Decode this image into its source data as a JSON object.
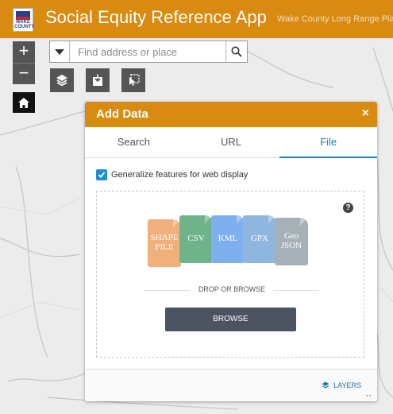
{
  "header": {
    "logo_text": "WAKE COUNTY",
    "title": "Social Equity Reference App",
    "subtitle": "Wake County Long Range Pla"
  },
  "map_controls": {
    "zoom_in": "+",
    "zoom_out": "−"
  },
  "search": {
    "placeholder": "Find address or place"
  },
  "add_data": {
    "title": "Add Data",
    "close": "×",
    "tabs": [
      {
        "label": "Search",
        "active": false
      },
      {
        "label": "URL",
        "active": false
      },
      {
        "label": "File",
        "active": true
      }
    ],
    "generalize_label": "Generalize features for web display",
    "generalize_checked": true,
    "help": "?",
    "file_types": [
      {
        "label": "SHAPE FILE",
        "color": "#f0b07c"
      },
      {
        "label": "CSV",
        "color": "#6fb38b"
      },
      {
        "label": "KML",
        "color": "#7fb0ee"
      },
      {
        "label": "GPX",
        "color": "#8fb6df"
      },
      {
        "label": "Geo JSON",
        "color": "#a6b0b7"
      }
    ],
    "drop_text": "DROP OR BROWSE",
    "browse_label": "BROWSE",
    "layers_label": "LAYERS"
  },
  "colors": {
    "brand": "#d98a10",
    "accent": "#0a89c5",
    "button": "#4b5460"
  }
}
